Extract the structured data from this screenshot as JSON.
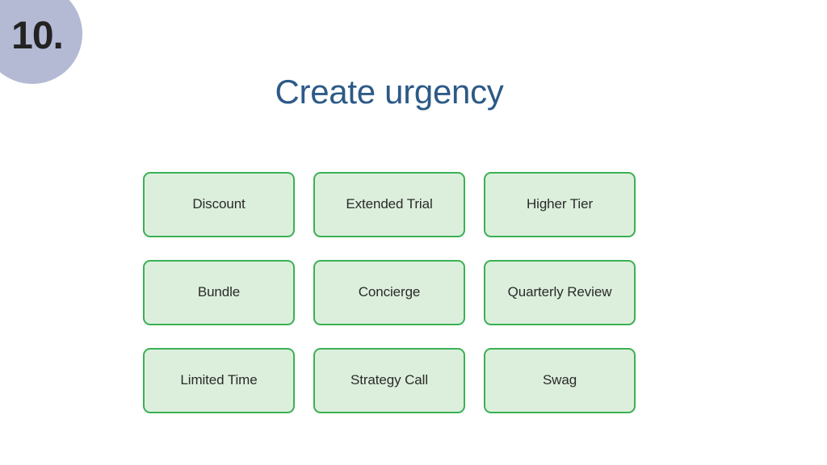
{
  "slide": {
    "background_color": "#ffffff",
    "badge": {
      "label": "10.",
      "circle_color": "#b4bad4",
      "text_color": "#232323"
    },
    "title": {
      "text": "Create urgency",
      "color": "#2d5a87"
    },
    "card_style": {
      "fill_color": "#dcefdc",
      "border_color": "#3bb054",
      "text_color": "#2a2a2a"
    },
    "cards": [
      {
        "label": "Discount"
      },
      {
        "label": "Extended Trial"
      },
      {
        "label": "Higher Tier"
      },
      {
        "label": "Bundle"
      },
      {
        "label": "Concierge"
      },
      {
        "label": "Quarterly Review"
      },
      {
        "label": "Limited Time"
      },
      {
        "label": "Strategy Call"
      },
      {
        "label": "Swag"
      }
    ]
  }
}
